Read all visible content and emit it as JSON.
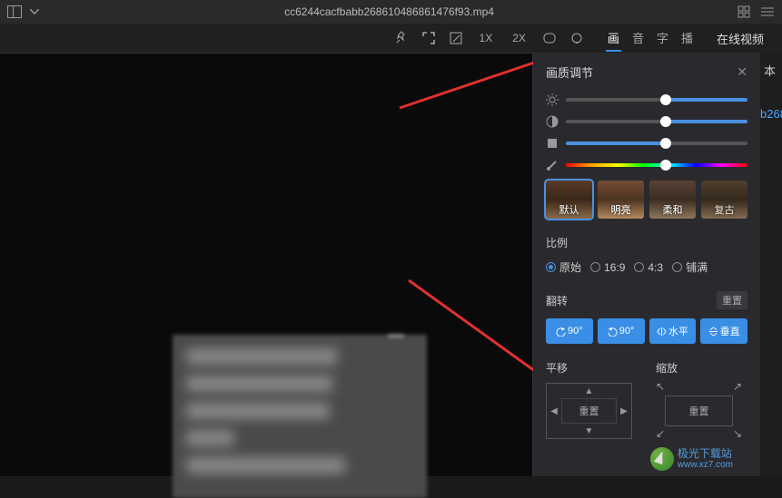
{
  "titlebar": {
    "filename": "cc6244cacfbabb268610486861476f93.mp4"
  },
  "toolbar": {
    "speed_1x": "1X",
    "speed_2x": "2X",
    "tabs": {
      "picture": "画",
      "audio": "音",
      "subtitle": "字",
      "play": "播"
    },
    "side_label": "在线视频",
    "right_tab": "本",
    "file_link": "b268"
  },
  "panel": {
    "title": "画质调节",
    "presets": {
      "default": "默认",
      "bright": "明亮",
      "soft": "柔和",
      "retro": "复古"
    },
    "ratio": {
      "label": "比例",
      "original": "原始",
      "r169": "16:9",
      "r43": "4:3",
      "fill": "铺满"
    },
    "flip": {
      "label": "翻转",
      "reset": "重置",
      "left90": "90°",
      "right90": "90°",
      "horizontal": "水平",
      "vertical": "垂直"
    },
    "pan": {
      "label": "平移",
      "reset": "重置"
    },
    "zoom": {
      "label": "缩放",
      "reset": "重置"
    }
  },
  "watermark": {
    "name": "极光下载站",
    "url": "www.xz7.com"
  }
}
